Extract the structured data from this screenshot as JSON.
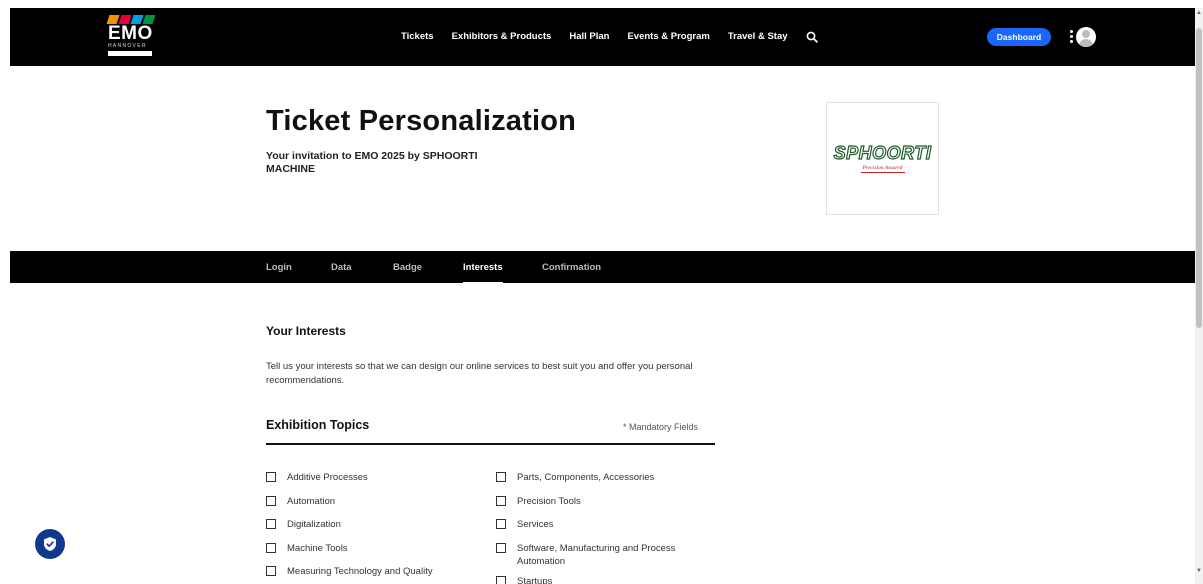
{
  "header": {
    "logo": {
      "text": "EMO",
      "sub": "HANNOVER",
      "stripe_colors": [
        "#f39200",
        "#e4003a",
        "#00a0e3",
        "#009640"
      ]
    },
    "nav": [
      "Tickets",
      "Exhibitors & Products",
      "Hall Plan",
      "Events & Program",
      "Travel & Stay"
    ],
    "dashboard_label": "Dashboard"
  },
  "hero": {
    "title": "Ticket Personalization",
    "subtitle": "Your invitation to EMO 2025 by SPHOORTI MACHINE",
    "sponsor_brand": "SPHOORTI",
    "sponsor_slogan": "Precision Assured"
  },
  "tabs": [
    {
      "label": "Login",
      "active": false
    },
    {
      "label": "Data",
      "active": false
    },
    {
      "label": "Badge",
      "active": false
    },
    {
      "label": "Interests",
      "active": true
    },
    {
      "label": "Confirmation",
      "active": false
    }
  ],
  "interests": {
    "title": "Your Interests",
    "intro": "Tell us your interests so that we can design our online services to best suit you and offer you personal recommendations.",
    "topics_title": "Exhibition Topics",
    "mandatory_note": "* Mandatory Fields",
    "left_options": [
      "Additive Processes",
      "Automation",
      "Digitalization",
      "Machine Tools",
      "Measuring Technology and Quality"
    ],
    "right_options": [
      "Parts, Components, Accessories",
      "Precision Tools",
      "Services",
      "Software, Manufacturing and Process Automation",
      "Startups"
    ]
  },
  "colors": {
    "header_bg": "#000000",
    "accent": "#1a66ff",
    "security_badge": "#123a8c"
  }
}
